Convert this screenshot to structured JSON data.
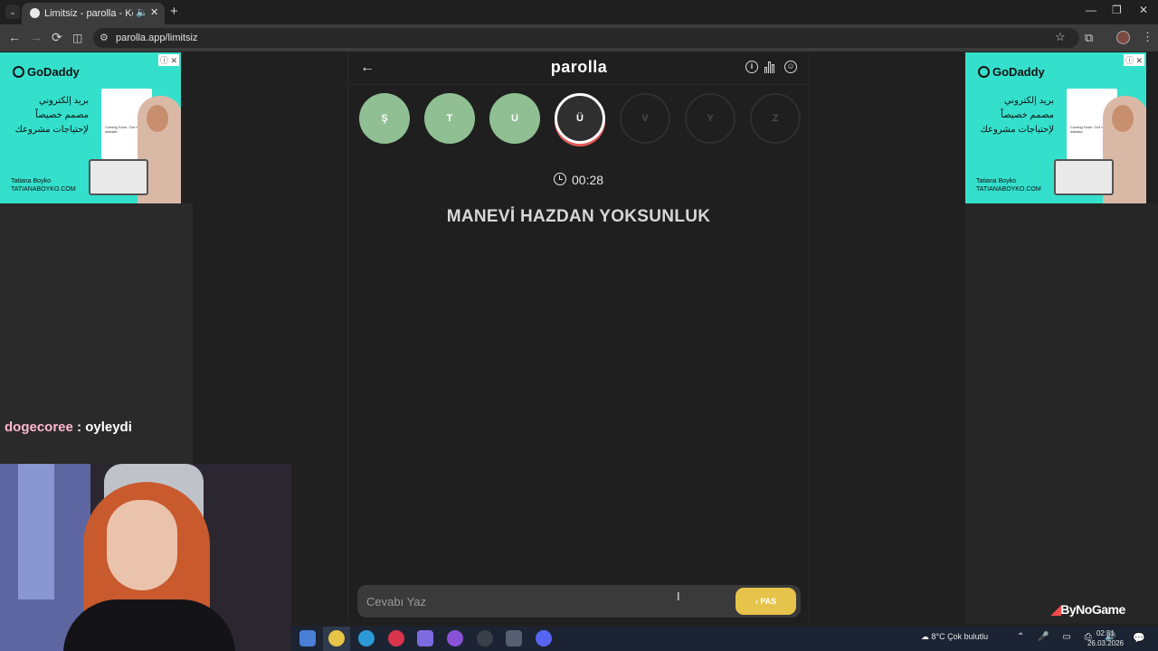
{
  "browser": {
    "tab_title": "Limitsiz - parolla - Kelime oyunu",
    "url": "parolla.app/limitsiz",
    "newtab_label": "+",
    "tab_close": "✕",
    "back": "←",
    "forward": "→",
    "reload": "⟳",
    "star": "☆",
    "menu": "⋮"
  },
  "ads": {
    "left": {
      "brand": "GoDaddy",
      "text": "بريد إلكتروني مصمم خصيصاً لإحتياجات مشروعك",
      "card_text": "Coming Soon. Our new website.",
      "name": "Tatiana Boyko",
      "site": "TATIANABOYKO.COM"
    },
    "right": {
      "brand": "GoDaddy",
      "text": "بريد إلكتروني مصمم خصيصاً لإحتياجات مشروعك",
      "card_text": "Coming Soon. Our new website.",
      "name": "Tatiana Boyko",
      "site": "TATIANABOYKO.COM"
    }
  },
  "stream": {
    "chat_user": "dogecoree",
    "chat_message": " : oyleydi",
    "watermark_mark": "◢",
    "watermark": "ByNoGame"
  },
  "game": {
    "brand": "parolla",
    "back_icon": "←",
    "info_icon": "i",
    "letters": [
      {
        "char": "Ş",
        "state": "done"
      },
      {
        "char": "T",
        "state": "done"
      },
      {
        "char": "U",
        "state": "done"
      },
      {
        "char": "Ü",
        "state": "current"
      },
      {
        "char": "V",
        "state": "todo"
      },
      {
        "char": "Y",
        "state": "todo"
      },
      {
        "char": "Z",
        "state": "todo"
      }
    ],
    "timer": "00:28",
    "question": "MANEVİ HAZDAN YOKSUNLUK",
    "answer_placeholder": "Cevabı Yaz",
    "pass_label": "›  PAS"
  },
  "taskbar": {
    "weather": "8°C  Çok bulutlu",
    "tray": "⌃ 🎤 ▭ ⎙ 🔊",
    "time": "02:51",
    "date": "26.03.2026",
    "notification": "💬"
  },
  "colors": {
    "done": "#8fbf92",
    "current_ring": "#ffffff",
    "pass": "#e6c34a",
    "ad_bg": "#34e0cc"
  }
}
